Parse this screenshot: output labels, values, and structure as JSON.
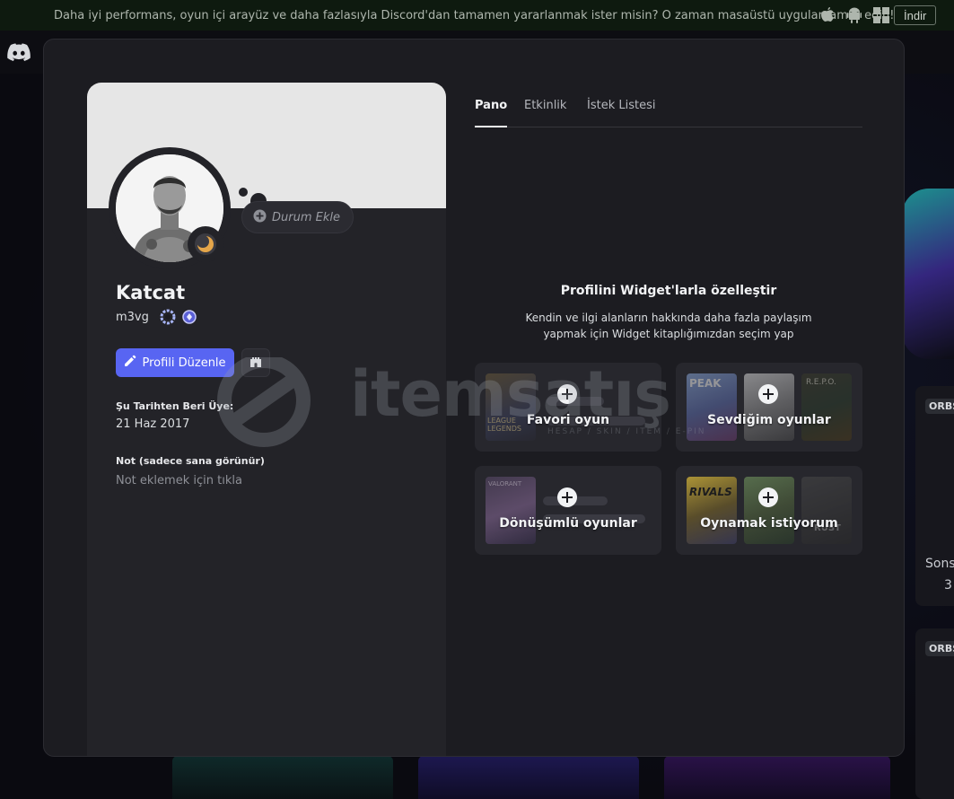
{
  "banner": {
    "text": "Daha iyi performans, oyun içi arayüz ve daha fazlasıyla Discord'dan tamamen yararlanmak ister misin? O zaman masaüstü uygulamamızı edin!",
    "download_label": "İndir",
    "icons": [
      "apple-icon",
      "android-icon",
      "windows-icon"
    ]
  },
  "background": {
    "orbs_label": "ORBS",
    "side_text": "Sons",
    "side_count": "3"
  },
  "profile": {
    "status_placeholder": "Durum Ekle",
    "display_name": "Katcat",
    "username": "m3vg",
    "edit_label": "Profili Düzenle",
    "member_since_label": "Şu Tarihten Beri Üye:",
    "member_since": "21 Haz 2017",
    "note_label": "Not (sadece sana görünür)",
    "note_placeholder": "Not eklemek için tıkla"
  },
  "tabs": [
    {
      "label": "Pano",
      "active": true
    },
    {
      "label": "Etkinlik",
      "active": false
    },
    {
      "label": "İstek Listesi",
      "active": false
    }
  ],
  "widgets": {
    "title": "Profilini Widget'larla özelleştir",
    "subtitle_line1": "Kendin ve ilgi alanların hakkında daha fazla paylaşım",
    "subtitle_line2": "yapmak için Widget kitaplığımızdan seçim yap",
    "cards": [
      {
        "label": "Favori oyun",
        "thumb_text": "LEAGUE LEGENDS"
      },
      {
        "label": "Sevdiğim oyunlar",
        "thumb_texts": [
          "PEAK",
          "",
          "R.E.P.O."
        ]
      },
      {
        "label": "Dönüşümlü oyunlar",
        "thumb_text": "VALORANT"
      },
      {
        "label": "Oynamak istiyorum",
        "thumb_texts": [
          "RIVALS",
          "",
          "RUST"
        ]
      }
    ]
  },
  "watermark": {
    "text": "itemsatış",
    "sub": "HESAP / SKIN / ITEM / E-PIN"
  },
  "colors": {
    "accent": "#5865f2",
    "modal_bg": "#1c1c21",
    "panel_bg": "#232328",
    "banner_bg": "#0e1a0f"
  }
}
